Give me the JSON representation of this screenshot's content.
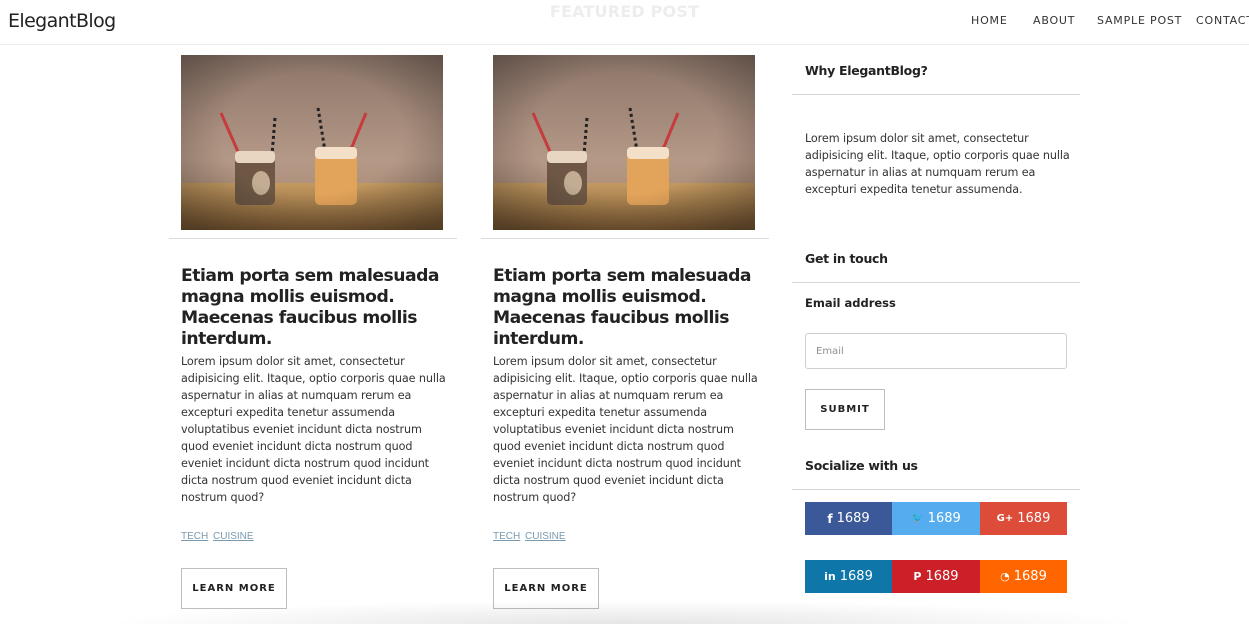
{
  "header": {
    "brand": "ElegantBlog",
    "featured_label": "FEATURED POST",
    "nav": [
      "HOME",
      "ABOUT",
      "SAMPLE POST",
      "CONTACT"
    ]
  },
  "posts": [
    {
      "title": "Etiam porta sem malesuada magna mollis euismod. Maecenas faucibus mollis interdum.",
      "body": "Lorem ipsum dolor sit amet, consectetur adipisicing elit. Itaque, optio corporis quae nulla aspernatur in alias at numquam rerum ea excepturi expedita tenetur assumenda voluptatibus eveniet incidunt dicta nostrum quod eveniet incidunt dicta nostrum quod eveniet incidunt dicta nostrum quod incidunt dicta nostrum quod eveniet incidunt dicta nostrum quod?",
      "tags": [
        "TECH",
        "CUISINE"
      ],
      "cta": "LEARN MORE"
    },
    {
      "title": "Etiam porta sem malesuada magna mollis euismod. Maecenas faucibus mollis interdum.",
      "body": "Lorem ipsum dolor sit amet, consectetur adipisicing elit. Itaque, optio corporis quae nulla aspernatur in alias at numquam rerum ea excepturi expedita tenetur assumenda voluptatibus eveniet incidunt dicta nostrum quod eveniet incidunt dicta nostrum quod eveniet incidunt dicta nostrum quod incidunt dicta nostrum quod eveniet incidunt dicta nostrum quod?",
      "tags": [
        "TECH",
        "CUISINE"
      ],
      "cta": "LEARN MORE"
    }
  ],
  "sidebar": {
    "why_title": "Why ElegantBlog?",
    "why_text": "Lorem ipsum dolor sit amet, consectetur adipisicing elit. Itaque, optio corporis quae nulla aspernatur in alias at numquam rerum ea excepturi expedita tenetur assumenda.",
    "contact_title": "Get in touch",
    "email_label": "Email address",
    "email_placeholder": "Email",
    "submit_label": "SUBMIT",
    "social_title": "Socialize with us",
    "social": [
      {
        "network": "facebook",
        "glyph": "f",
        "count": "1689",
        "color": "#3b5998"
      },
      {
        "network": "twitter",
        "glyph": "🐦",
        "count": "1689",
        "color": "#55acee"
      },
      {
        "network": "google-plus",
        "glyph": "G+",
        "count": "1689",
        "color": "#dd4b39"
      },
      {
        "network": "linkedin",
        "glyph": "in",
        "count": "1689",
        "color": "#0e76a8"
      },
      {
        "network": "pinterest",
        "glyph": "P",
        "count": "1689",
        "color": "#cb2027"
      },
      {
        "network": "rss",
        "glyph": "◔",
        "count": "1689",
        "color": "#ff6600"
      }
    ]
  }
}
